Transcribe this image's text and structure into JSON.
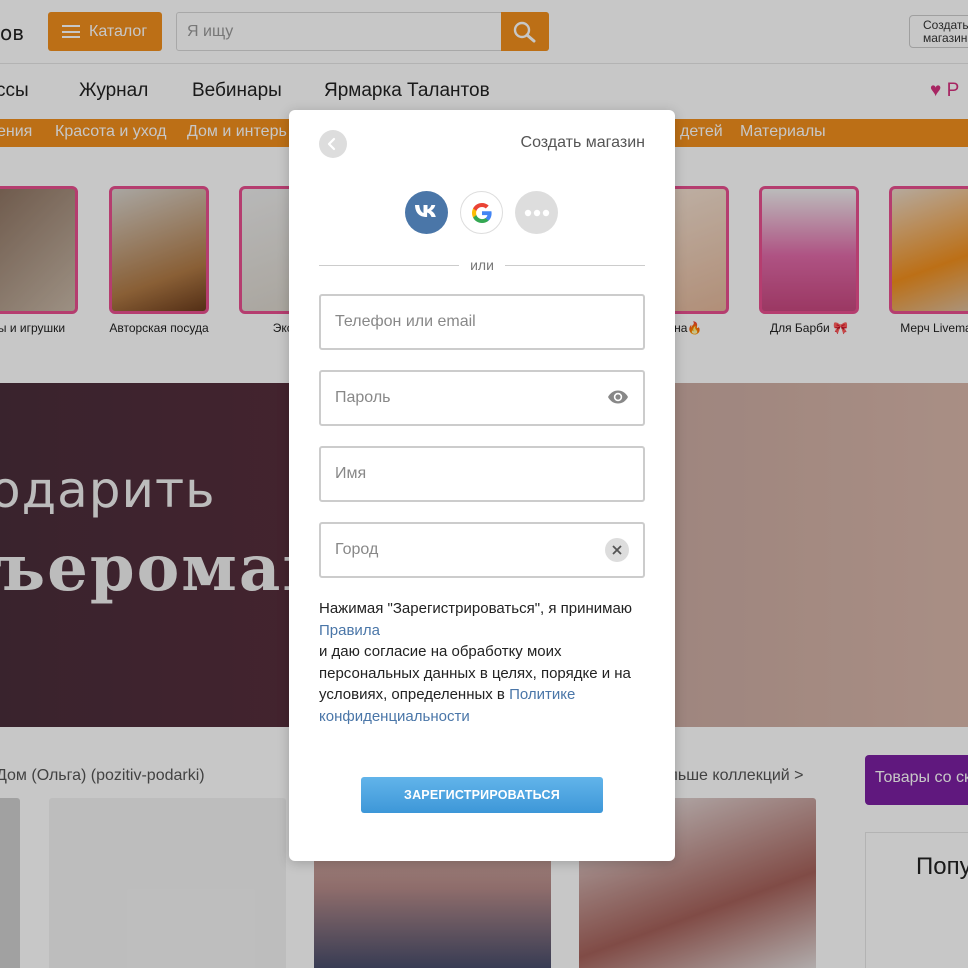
{
  "header": {
    "logo_tail": "ов",
    "catalog_label": "Каталог",
    "search_placeholder": "Я ищу",
    "create_shop_label": "Создать магазин"
  },
  "nav": {
    "items": [
      "ссы",
      "Журнал",
      "Вебинары",
      "Ярмарка Талантов"
    ],
    "favorites_fragment": "Р"
  },
  "category_bar": [
    "ения",
    "Красота и уход",
    "Дом и интерь",
    "детей",
    "Материалы"
  ],
  "tiles": [
    {
      "caption": "лы и игрушки"
    },
    {
      "caption": "Авторская посуда"
    },
    {
      "caption": "Экскл"
    },
    {
      "caption": "езона🔥"
    },
    {
      "caption": "Для Барби 🎀"
    },
    {
      "caption": "Мерч Livemas"
    }
  ],
  "banner": {
    "line1": "одарить",
    "line2": "ъероману?"
  },
  "lower": {
    "shop_link": "Дом (Ольга) (pozitiv-podarki)",
    "more_collections": "ольше коллекций >",
    "goods_button": "Товары со ск",
    "popular": "Попу"
  },
  "modal": {
    "create_shop_link": "Создать магазин",
    "divider_text": "или",
    "fields": {
      "phone_placeholder": "Телефон или email",
      "password_placeholder": "Пароль",
      "name_placeholder": "Имя",
      "city_placeholder": "Город"
    },
    "consent": {
      "part1": "Нажимая \"Зарегистрироваться\", я принимаю ",
      "rules_link": "Правила",
      "part2": "и даю согласие на обработку моих персональных данных в целях, порядке и на условиях, определенных в ",
      "policy_link": "Политике конфиденциальности"
    },
    "register_label": "ЗАРЕГИСТРИРОВАТЬСЯ"
  },
  "colors": {
    "brand_orange": "#f18f1d",
    "vk_blue": "#4a76a8",
    "link_blue": "#4a76a8",
    "button_blue": "#3d97d8",
    "purple": "#7b1fa2"
  },
  "icons": [
    "burger-icon",
    "search-icon",
    "heart-icon",
    "back-chevron-icon",
    "vk-icon",
    "google-icon",
    "more-dots-icon",
    "eye-icon",
    "clear-icon"
  ]
}
